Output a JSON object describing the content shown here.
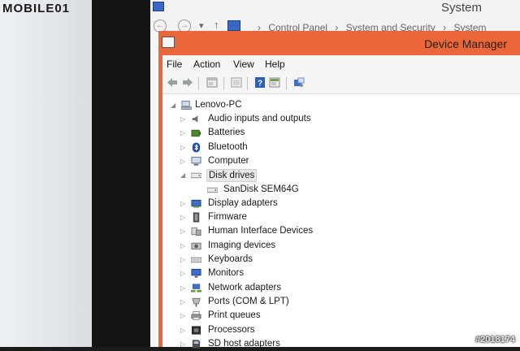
{
  "watermark_top": "MOBILE01",
  "watermark_bottom": "#2018174",
  "system_window": {
    "title": "System",
    "nav_back": "←",
    "nav_forward": "→",
    "nav_up": "↑",
    "breadcrumbs": [
      "Control Panel",
      "System and Security",
      "System"
    ]
  },
  "device_manager": {
    "title": "Device Manager",
    "menu": [
      "File",
      "Action",
      "View",
      "Help"
    ],
    "toolbar": [
      "back",
      "forward",
      "properties",
      "show-hide",
      "help",
      "update",
      "scan"
    ],
    "tree": {
      "root": "Lenovo-PC",
      "items": [
        {
          "label": "Audio inputs and outputs",
          "icon": "speaker-icon",
          "expanded": false
        },
        {
          "label": "Batteries",
          "icon": "battery-icon",
          "expanded": false
        },
        {
          "label": "Bluetooth",
          "icon": "bluetooth-icon",
          "expanded": false
        },
        {
          "label": "Computer",
          "icon": "computer-icon",
          "expanded": false
        },
        {
          "label": "Disk drives",
          "icon": "disk-drive-icon",
          "expanded": true,
          "selected": true,
          "children": [
            {
              "label": "SanDisk SEM64G",
              "icon": "disk-drive-icon"
            }
          ]
        },
        {
          "label": "Display adapters",
          "icon": "display-adapter-icon",
          "expanded": false
        },
        {
          "label": "Firmware",
          "icon": "firmware-icon",
          "expanded": false
        },
        {
          "label": "Human Interface Devices",
          "icon": "hid-icon",
          "expanded": false
        },
        {
          "label": "Imaging devices",
          "icon": "camera-icon",
          "expanded": false
        },
        {
          "label": "Keyboards",
          "icon": "keyboard-icon",
          "expanded": false
        },
        {
          "label": "Monitors",
          "icon": "monitor-icon",
          "expanded": false
        },
        {
          "label": "Network adapters",
          "icon": "network-icon",
          "expanded": false
        },
        {
          "label": "Ports (COM & LPT)",
          "icon": "port-icon",
          "expanded": false
        },
        {
          "label": "Print queues",
          "icon": "printer-icon",
          "expanded": false
        },
        {
          "label": "Processors",
          "icon": "processor-icon",
          "expanded": false
        },
        {
          "label": "SD host adapters",
          "icon": "sd-card-icon",
          "expanded": false
        }
      ]
    }
  },
  "colors": {
    "titlebar_accent": "#e9673b",
    "window_bg": "#ffffff"
  }
}
